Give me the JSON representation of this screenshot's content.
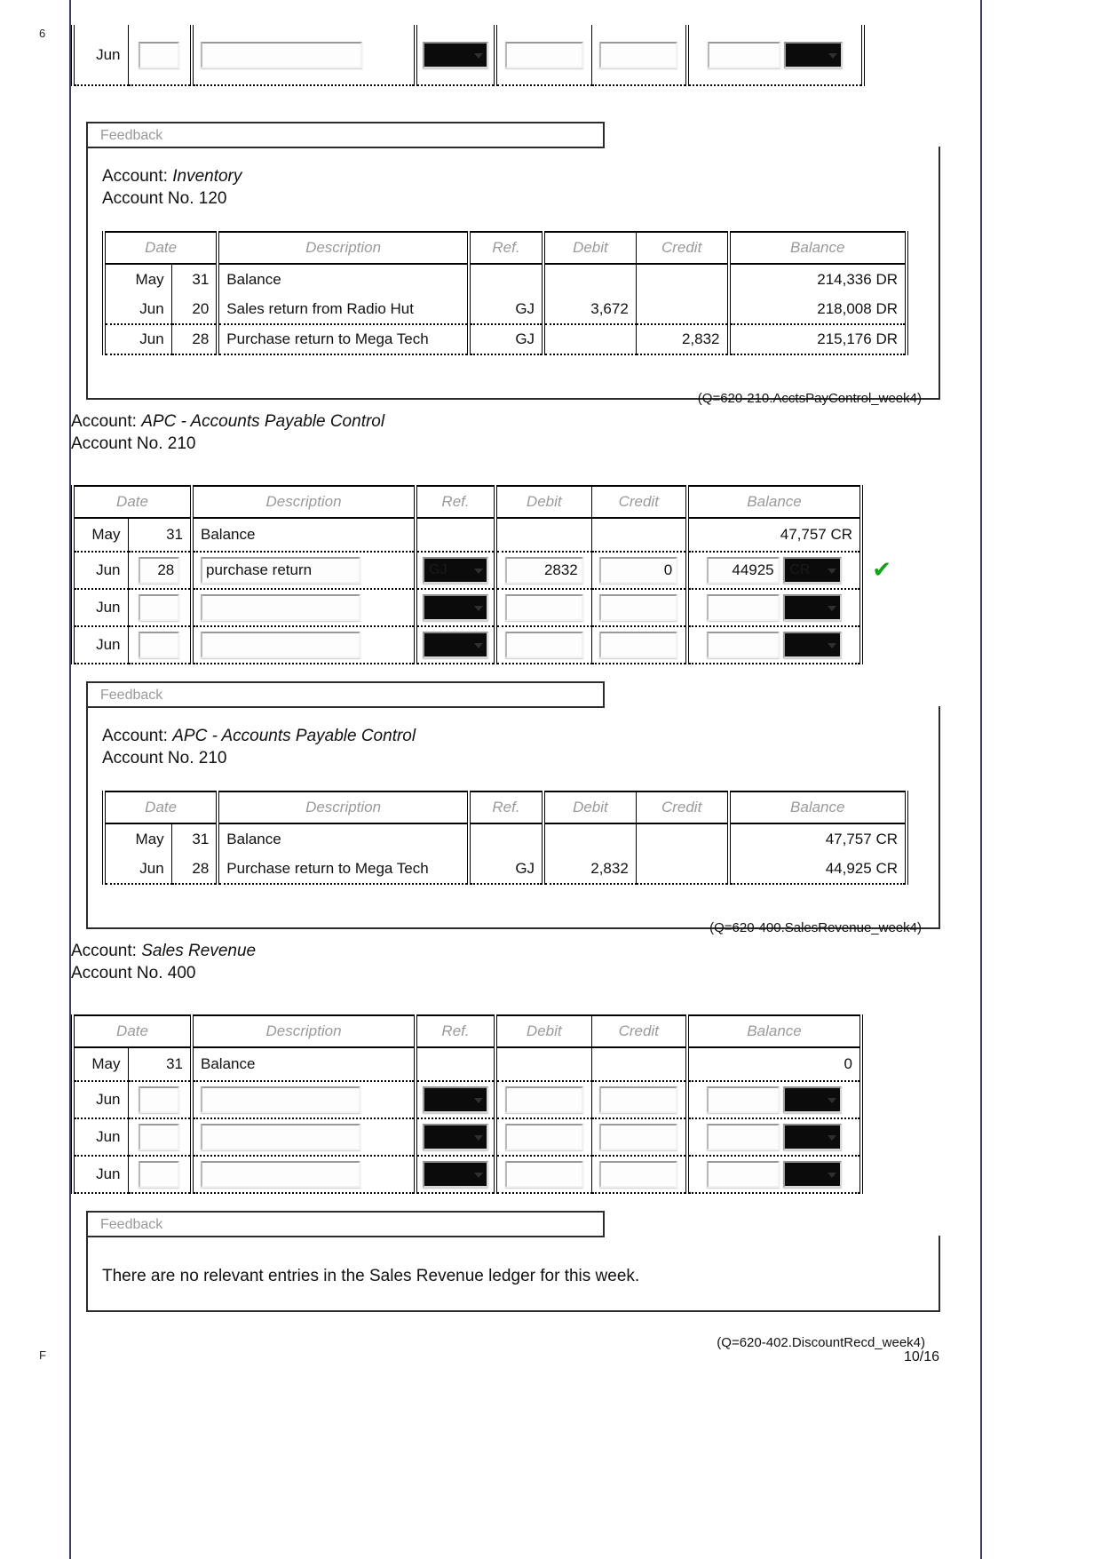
{
  "page": {
    "number": "10/16",
    "left_edge_top": "6",
    "left_edge_bottom": "F"
  },
  "top_partial_row": {
    "month": "Jun",
    "day_value": "",
    "description_value": "",
    "ref_value": "",
    "debit_value": "",
    "credit_value": "",
    "balance_value": "",
    "dc_value": ""
  },
  "columns": {
    "date": "Date",
    "description": "Description",
    "ref": "Ref.",
    "debit": "Debit",
    "credit": "Credit",
    "balance": "Balance"
  },
  "feedback_label": "Feedback",
  "sections": [
    {
      "id": "inventory-feedback",
      "kind": "feedback",
      "account_prefix": "Account: ",
      "account_name": "Inventory",
      "account_no_label": "Account No. 120",
      "rows": [
        {
          "month": "May",
          "day": "31",
          "description": "Balance",
          "ref": "",
          "debit": "",
          "credit": "",
          "balance": "214,336 DR"
        },
        {
          "month": "Jun",
          "day": "20",
          "description": "Sales return from Radio Hut",
          "ref": "GJ",
          "debit": "3,672",
          "credit": "",
          "balance": "218,008 DR"
        },
        {
          "month": "Jun",
          "day": "28",
          "description": "Purchase return to Mega Tech",
          "ref": "GJ",
          "debit": "",
          "credit": "2,832",
          "balance": "215,176 DR"
        }
      ]
    },
    {
      "id": "apc-input",
      "kind": "input",
      "qtag": "(Q=620-210.AcctsPayControl_week4)",
      "account_prefix": "Account: ",
      "account_name": "APC - Accounts Payable Control",
      "account_no_label": "Account No. 210",
      "static_row": {
        "month": "May",
        "day": "31",
        "description": "Balance",
        "ref": "",
        "debit": "",
        "credit": "",
        "balance": "47,757 CR"
      },
      "input_rows": [
        {
          "month": "Jun",
          "day_value": "28",
          "description_value": "purchase return",
          "ref_value": "GJ",
          "debit_value": "2832",
          "credit_value": "0",
          "balance_value": "44925",
          "dc_value": "CR",
          "marked": true,
          "mark_glyph": "✔"
        },
        {
          "month": "Jun",
          "day_value": "",
          "description_value": "",
          "ref_value": "",
          "debit_value": "",
          "credit_value": "",
          "balance_value": "",
          "dc_value": "",
          "marked": false,
          "mark_glyph": ""
        },
        {
          "month": "Jun",
          "day_value": "",
          "description_value": "",
          "ref_value": "",
          "debit_value": "",
          "credit_value": "",
          "balance_value": "",
          "dc_value": "",
          "marked": false,
          "mark_glyph": ""
        }
      ]
    },
    {
      "id": "apc-feedback",
      "kind": "feedback",
      "account_prefix": "Account: ",
      "account_name": "APC - Accounts Payable Control",
      "account_no_label": "Account No. 210",
      "rows": [
        {
          "month": "May",
          "day": "31",
          "description": "Balance",
          "ref": "",
          "debit": "",
          "credit": "",
          "balance": "47,757 CR"
        },
        {
          "month": "Jun",
          "day": "28",
          "description": "Purchase return to Mega Tech",
          "ref": "GJ",
          "debit": "2,832",
          "credit": "",
          "balance": "44,925 CR"
        }
      ]
    },
    {
      "id": "sales-revenue-input",
      "kind": "input",
      "qtag": "(Q=620-400.SalesRevenue_week4)",
      "account_prefix": "Account: ",
      "account_name": "Sales Revenue",
      "account_no_label": "Account No. 400",
      "static_row": {
        "month": "May",
        "day": "31",
        "description": "Balance",
        "ref": "",
        "debit": "",
        "credit": "",
        "balance": "0"
      },
      "input_rows": [
        {
          "month": "Jun",
          "day_value": "",
          "description_value": "",
          "ref_value": "",
          "debit_value": "",
          "credit_value": "",
          "balance_value": "",
          "dc_value": "",
          "marked": false,
          "mark_glyph": ""
        },
        {
          "month": "Jun",
          "day_value": "",
          "description_value": "",
          "ref_value": "",
          "debit_value": "",
          "credit_value": "",
          "balance_value": "",
          "dc_value": "",
          "marked": false,
          "mark_glyph": ""
        },
        {
          "month": "Jun",
          "day_value": "",
          "description_value": "",
          "ref_value": "",
          "debit_value": "",
          "credit_value": "",
          "balance_value": "",
          "dc_value": "",
          "marked": false,
          "mark_glyph": ""
        }
      ]
    },
    {
      "id": "sales-revenue-feedback",
      "kind": "feedback-text",
      "text": "There are no relevant entries in the Sales Revenue ledger for this week.",
      "qtag": "(Q=620-402.DiscountRecd_week4)"
    }
  ]
}
